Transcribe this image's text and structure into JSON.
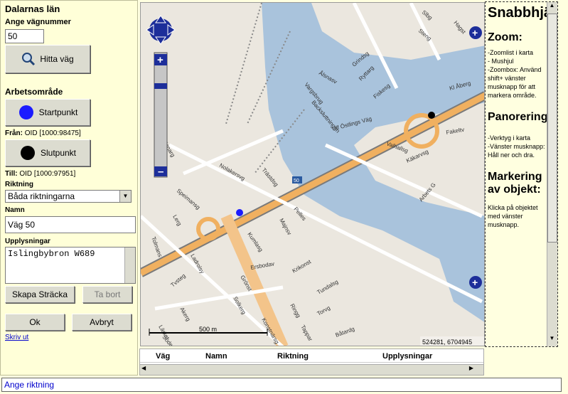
{
  "left": {
    "title": "Dalarnas län",
    "road_number_label": "Ange vägnummer",
    "road_number_value": "50",
    "find_road_button": "Hitta väg",
    "work_area_title": "Arbetsområde",
    "start_button": "Startpunkt",
    "from_label": "Från:",
    "from_value": "OID [1000:98475]",
    "end_button": "Slutpunkt",
    "to_label": "Till:",
    "to_value": "OID [1000:97951]",
    "direction_label": "Riktning",
    "direction_value": "Båda riktningarna",
    "name_label": "Namn",
    "name_value": "Väg 50",
    "info_label": "Upplysningar",
    "info_value": "Islingbybron W689",
    "create_button": "Skapa Sträcka",
    "remove_button": "Ta bort",
    "ok_button": "Ok",
    "cancel_button": "Avbryt",
    "print_link": "Skriv ut"
  },
  "map": {
    "scale_label": "500 m",
    "coords": "524281, 6704945",
    "road_labels": [
      "Slbg",
      "Hagst",
      "Steng",
      "Grindsg",
      "Vargsbrug",
      "Backsluttningen",
      "Ryttarg",
      "Fiskesg",
      "Kl Åberg",
      "Ulf Östlings Väg",
      "Valhallsg",
      "Fakeltv",
      "Käkarvsg",
      "Arbets G",
      "Skinnarg",
      "Nolakersvg",
      "Trästdsg",
      "Speimansg",
      "Pelles",
      "Kumlasg",
      "Majnsv",
      "Lerg",
      "Tolmans",
      "Ladrolsy",
      "Ersbodav",
      "Grönst",
      "Krikonst",
      "Tundalsg",
      "Ringg",
      "Torvg",
      "Tvsteg",
      "Akerg",
      "Solkerg",
      "Konstnärsg",
      "Båtardg",
      "Tappar",
      "Lärkst",
      "Söderg",
      "Ålsnasv"
    ],
    "route_number": "50"
  },
  "help": {
    "title": "Snabbhjälp",
    "zoom_title": "Zoom:",
    "zoom_text": [
      "-Zoomlist i karta",
      "- Mushjul",
      "-Zoombox: Använd shift+ vänster musknapp för att markera område."
    ],
    "pan_title": "Panorering:",
    "pan_text": [
      "-Verktyg i karta",
      "-Vänster musknapp: Håll ner och dra."
    ],
    "mark_title": "Markering av objekt:",
    "mark_text": [
      "Klicka på objektet med vänster musknapp."
    ]
  },
  "grid": {
    "columns": [
      "Väg",
      "Namn",
      "Riktning",
      "Upplysningar"
    ]
  },
  "status": "Ange riktning"
}
